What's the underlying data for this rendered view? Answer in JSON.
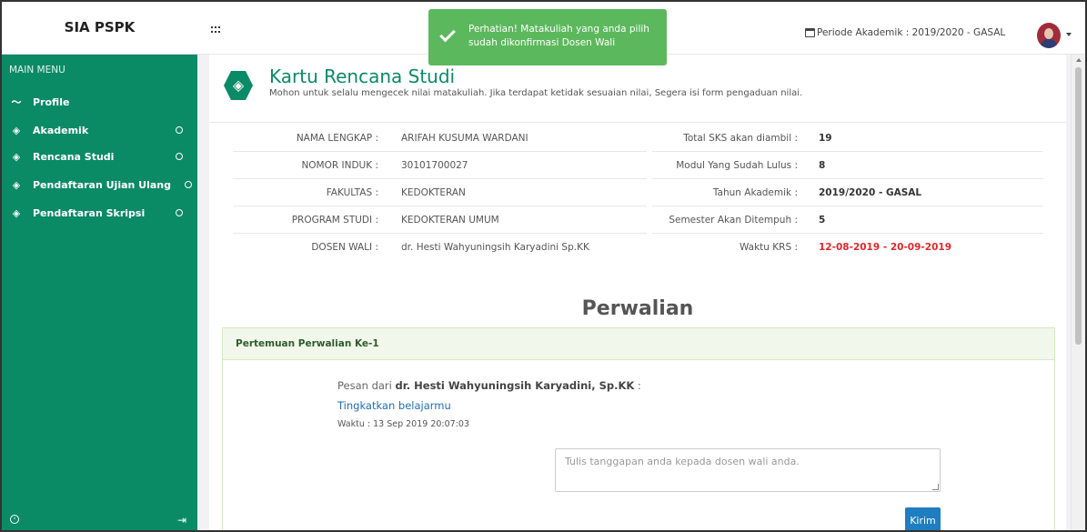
{
  "header": {
    "brand": "SIA PSPK",
    "periode": "Periode Akademik : 2019/2020 - GASAL"
  },
  "toast": {
    "message": "Perhatian! Matakuliah yang anda pilih sudah dikonfirmasi Dosen Wali",
    "color": "#5cb85c"
  },
  "sidebar": {
    "menu_title": "MAIN MENU",
    "items": [
      {
        "label": "Profile",
        "icon": "chart-line-icon"
      },
      {
        "label": "Akademik",
        "icon": "layers-icon"
      },
      {
        "label": "Rencana Studi",
        "icon": "layers-icon"
      },
      {
        "label": "Pendaftaran Ujian Ulang",
        "icon": "layers-icon"
      },
      {
        "label": "Pendaftaran Skripsi",
        "icon": "layers-icon"
      }
    ],
    "color": "#0b8a66"
  },
  "krs": {
    "title": "Kartu Rencana Studi",
    "subtitle": "Mohon untuk selalu mengecek nilai matakuliah. Jika terdapat ketidak sesuaian nilai, Segera isi form pengaduan nilai."
  },
  "student_left": [
    {
      "label": "NAMA LENGKAP :",
      "value": "ARIFAH KUSUMA WARDANI"
    },
    {
      "label": "NOMOR INDUK :",
      "value": "30101700027"
    },
    {
      "label": "FAKULTAS :",
      "value": "KEDOKTERAN"
    },
    {
      "label": "PROGRAM STUDI :",
      "value": "KEDOKTERAN UMUM"
    },
    {
      "label": "DOSEN WALI :",
      "value": "dr. Hesti Wahyuningsih Karyadini Sp.KK"
    }
  ],
  "student_right": [
    {
      "label": "Total SKS akan diambil :",
      "value": "19"
    },
    {
      "label": "Modul Yang Sudah Lulus :",
      "value": "8"
    },
    {
      "label": "Tahun Akademik :",
      "value": "2019/2020 - GASAL"
    },
    {
      "label": "Semester Akan Ditempuh :",
      "value": "5"
    },
    {
      "label": "Waktu KRS :",
      "value": "12-08-2019 - 20-09-2019"
    }
  ],
  "perwalian": {
    "title": "Perwalian",
    "panel_title": "Pertemuan Perwalian Ke-1",
    "from_prefix": "Pesan dari",
    "from_name": "dr. Hesti Wahyuningsih Karyadini, Sp.KK",
    "from_suffix": " :",
    "message": "Tingkatkan belajarmu",
    "time": "Waktu : 13 Sep 2019 20:07:03",
    "reply_placeholder": "Tulis tanggapan anda kepada dosen wali anda.",
    "submit_label": "Kirim"
  }
}
